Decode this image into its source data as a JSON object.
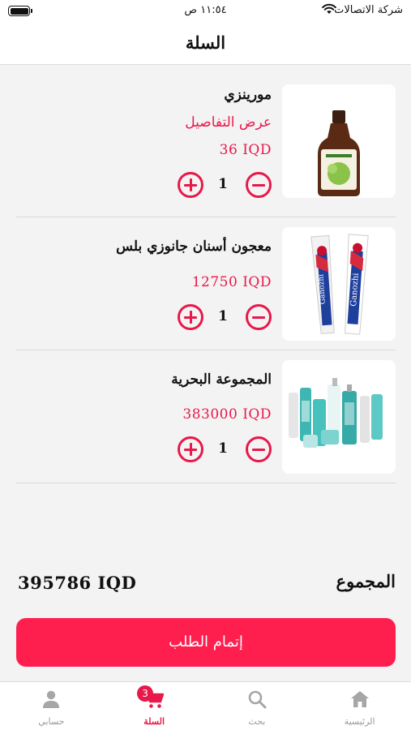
{
  "status_bar": {
    "carrier": "شركة الاتصالات",
    "time": "١١:٥٤ ص"
  },
  "header": {
    "title": "السلة"
  },
  "cart": {
    "items": [
      {
        "name": "مورينزي",
        "details_link": "عرض التفاصيل",
        "price": "36 IQD",
        "quantity": "1",
        "image": "syrup-bottle"
      },
      {
        "name": "معجون أسنان جانوزي بلس",
        "price": "12750 IQD",
        "quantity": "1",
        "image": "toothpaste-tube",
        "brand": "Ganozhi"
      },
      {
        "name": "المجموعة البحرية",
        "price": "383000 IQD",
        "quantity": "1",
        "image": "skincare-set"
      }
    ]
  },
  "summary": {
    "total_label": "المجموع",
    "total_value": "395786 IQD"
  },
  "checkout": {
    "label": "إتمام الطلب"
  },
  "tab_bar": {
    "tabs": [
      {
        "label": "الرئيسية",
        "icon": "home-icon"
      },
      {
        "label": "بحث",
        "icon": "search-icon"
      },
      {
        "label": "السلة",
        "icon": "cart-icon",
        "badge": "3",
        "active": true
      },
      {
        "label": "حسابي",
        "icon": "person-icon"
      }
    ]
  },
  "colors": {
    "accent": "#e8184a",
    "checkout": "#ff1f4f",
    "background": "#f3f3f3"
  }
}
